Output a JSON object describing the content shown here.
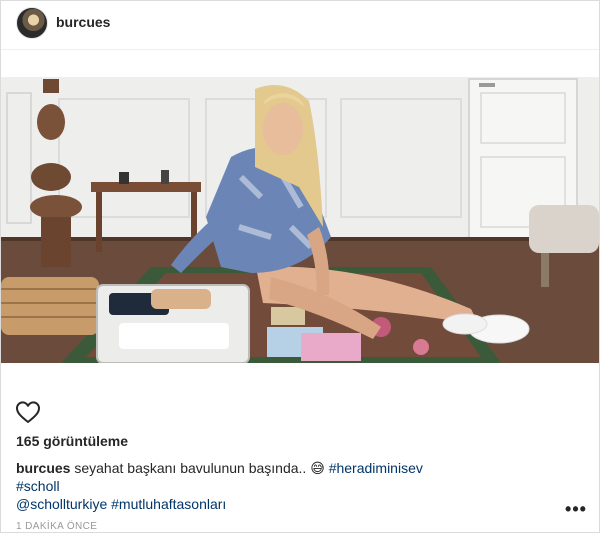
{
  "header": {
    "username": "burcues"
  },
  "media": {
    "description_icon": "video-frame"
  },
  "actions": {
    "like_icon": "heart-outline-icon"
  },
  "stats": {
    "views": "165 görüntüleme"
  },
  "caption": {
    "username": "burcues",
    "text": "seyahat başkanı bavulunun başında..",
    "emoji": "😅",
    "hashtag1": "#heradiminisev",
    "hashtag2": "#scholl",
    "mention": "@schollturkiye",
    "hashtag3": "#mutluhaftasonları"
  },
  "footer": {
    "timestamp": "1 DAKİKA ÖNCE",
    "more_label": "•••"
  },
  "colors": {
    "link": "#003569",
    "text": "#262626",
    "muted": "#999999",
    "border": "#dbdbdb"
  }
}
